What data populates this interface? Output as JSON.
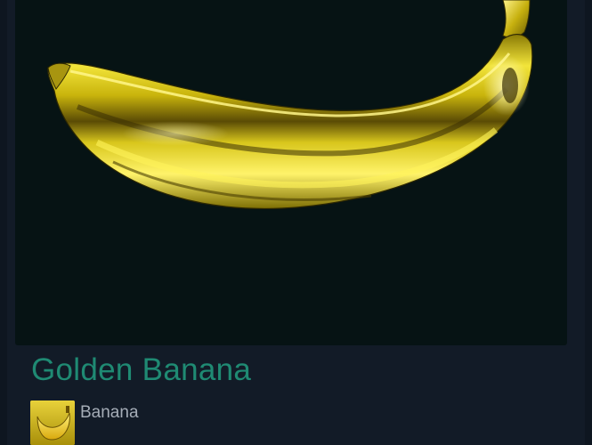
{
  "item": {
    "title": "Golden Banana",
    "image_icon": "golden-banana-image",
    "game": {
      "name": "Banana",
      "icon": "banana-game-icon"
    }
  },
  "colors": {
    "page_background": "#121b27",
    "image_background": "#061314",
    "title": "#1f8a73",
    "game_name": "#a5adb7",
    "gold": "#e6d21a"
  }
}
